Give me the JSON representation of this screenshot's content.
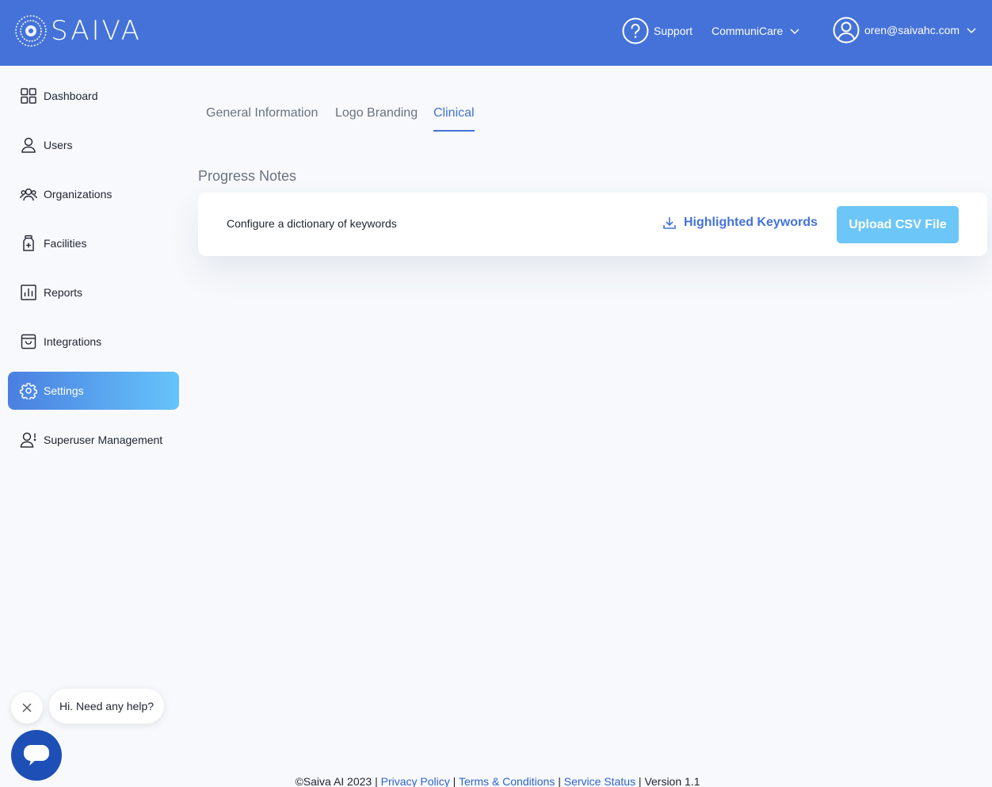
{
  "header": {
    "logo_text": "SAIVA",
    "support_label": "Support",
    "organization": "CommuniCare",
    "user_email": "oren@saivahc.com"
  },
  "sidebar": {
    "items": [
      {
        "label": "Dashboard",
        "icon": "grid-icon"
      },
      {
        "label": "Users",
        "icon": "user-icon"
      },
      {
        "label": "Organizations",
        "icon": "group-icon"
      },
      {
        "label": "Facilities",
        "icon": "medical-bottle-icon"
      },
      {
        "label": "Reports",
        "icon": "bar-chart-icon"
      },
      {
        "label": "Integrations",
        "icon": "shopping-bag-icon"
      },
      {
        "label": "Settings",
        "icon": "gear-icon",
        "active": true
      },
      {
        "label": "Superuser Management",
        "icon": "user-alert-icon"
      }
    ]
  },
  "tabs": [
    {
      "label": "General Information"
    },
    {
      "label": "Logo Branding"
    },
    {
      "label": "Clinical",
      "active": true
    }
  ],
  "section": {
    "title": "Progress Notes",
    "description": "Configure a dictionary of keywords",
    "download_label": "Highlighted Keywords",
    "upload_label": "Upload CSV File"
  },
  "chat": {
    "greeting": "Hi. Need any help?"
  },
  "footer": {
    "copyright": "©Saiva AI 2023",
    "sep": "|",
    "privacy": "Privacy Policy",
    "terms": "Terms & Conditions",
    "status": "Service Status",
    "version": "Version 1.1"
  },
  "colors": {
    "header_bg": "#4472d8",
    "accent": "#4472d8",
    "upload_button": "#6cc6f7",
    "chat_launcher": "#1d4fb6"
  }
}
